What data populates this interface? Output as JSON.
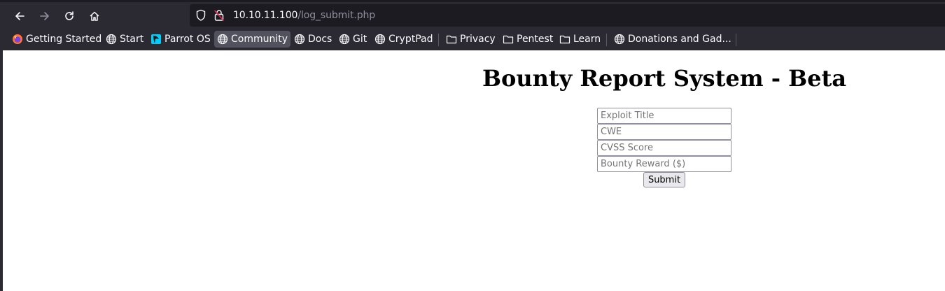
{
  "browser": {
    "url_host": "10.10.11.100",
    "url_path": "/log_submit.php",
    "nav_icons": [
      "back-arrow-icon",
      "forward-arrow-icon",
      "reload-icon",
      "home-icon"
    ],
    "bookmarks": [
      {
        "label": "Getting Started",
        "icon": "firefox-icon"
      },
      {
        "label": "Start",
        "icon": "globe-icon"
      },
      {
        "label": "Parrot OS",
        "icon": "parrot-icon"
      },
      {
        "label": "Community",
        "icon": "globe-icon"
      },
      {
        "label": "Docs",
        "icon": "globe-icon"
      },
      {
        "label": "Git",
        "icon": "globe-icon"
      },
      {
        "label": "CryptPad",
        "icon": "globe-icon"
      },
      {
        "label": "Privacy",
        "icon": "folder-icon"
      },
      {
        "label": "Pentest",
        "icon": "folder-icon"
      },
      {
        "label": "Learn",
        "icon": "folder-icon"
      },
      {
        "label": "Donations and Gad...",
        "icon": "globe-icon"
      }
    ],
    "colors": {
      "chrome_bg": "#2b2a33",
      "urlbar_bg": "#1c1b22",
      "active_bookmark": "#52525e"
    }
  },
  "page": {
    "title": "Bounty Report System - Beta",
    "form": {
      "exploit_title_placeholder": "Exploit Title",
      "cwe_placeholder": "CWE",
      "cvss_placeholder": "CVSS Score",
      "reward_placeholder": "Bounty Reward ($)",
      "submit_label": "Submit"
    }
  }
}
